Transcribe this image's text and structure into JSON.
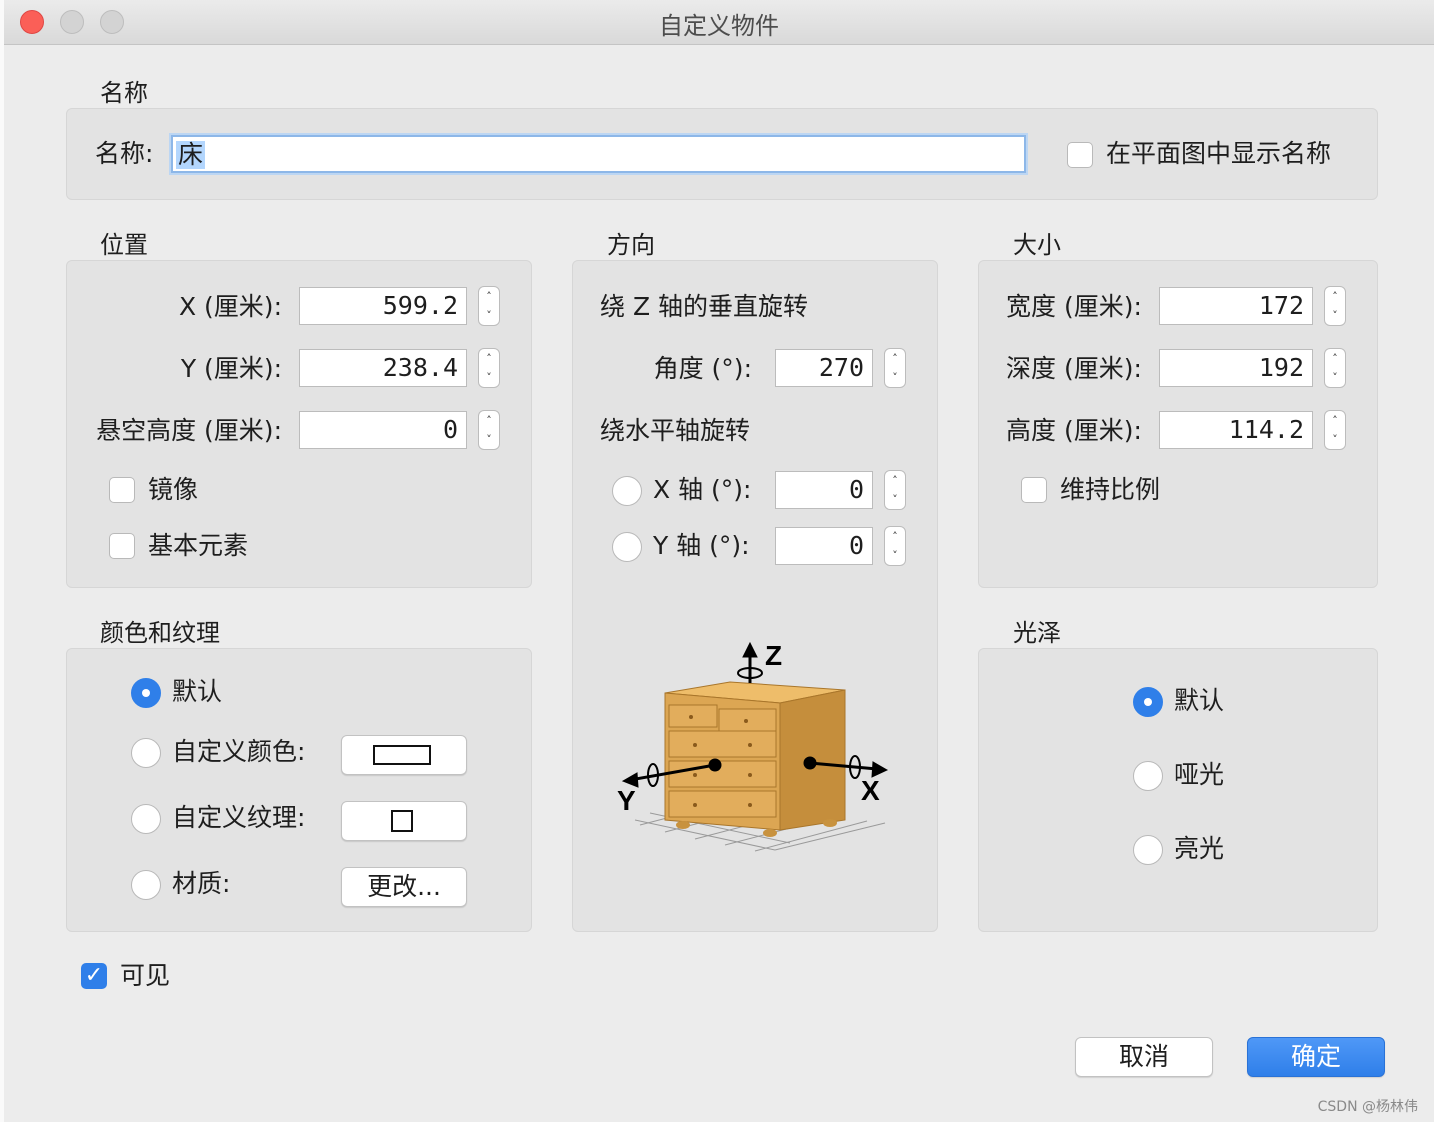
{
  "window": {
    "title": "自定义物件"
  },
  "name_section": {
    "title": "名称",
    "label": "名称:",
    "value": "床",
    "show_in_plan_label": "在平面图中显示名称",
    "show_in_plan_checked": false
  },
  "position": {
    "title": "位置",
    "x_label": "X (厘米):",
    "x_value": "599.2",
    "y_label": "Y (厘米):",
    "y_value": "238.4",
    "elevation_label": "悬空高度 (厘米):",
    "elevation_value": "0",
    "mirror_label": "镜像",
    "mirror_checked": false,
    "basic_label": "基本元素",
    "basic_checked": false
  },
  "orientation": {
    "title": "方向",
    "vertical_rotation_label": "绕 Z 轴的垂直旋转",
    "angle_label": "角度 (°):",
    "angle_value": "270",
    "horizontal_rotation_label": "绕水平轴旋转",
    "x_axis_label": "X 轴 (°):",
    "x_axis_value": "0",
    "y_axis_label": "Y 轴 (°):",
    "y_axis_value": "0",
    "axis_z": "Z",
    "axis_x": "X",
    "axis_y": "Y"
  },
  "size": {
    "title": "大小",
    "width_label": "宽度 (厘米):",
    "width_value": "172",
    "depth_label": "深度 (厘米):",
    "depth_value": "192",
    "height_label": "高度 (厘米):",
    "height_value": "114.2",
    "keep_ratio_label": "维持比例",
    "keep_ratio_checked": false
  },
  "color_texture": {
    "title": "颜色和纹理",
    "default_label": "默认",
    "custom_color_label": "自定义颜色:",
    "custom_texture_label": "自定义纹理:",
    "material_label": "材质:",
    "material_button": "更改...",
    "selected": "默认"
  },
  "shininess": {
    "title": "光泽",
    "default_label": "默认",
    "matte_label": "哑光",
    "glossy_label": "亮光",
    "selected": "默认"
  },
  "visible": {
    "label": "可见",
    "checked": true
  },
  "buttons": {
    "cancel": "取消",
    "ok": "确定"
  },
  "watermark": "CSDN @杨林伟",
  "colors": {
    "accent": "#2f7fe9",
    "wood": "#d9a24a"
  }
}
